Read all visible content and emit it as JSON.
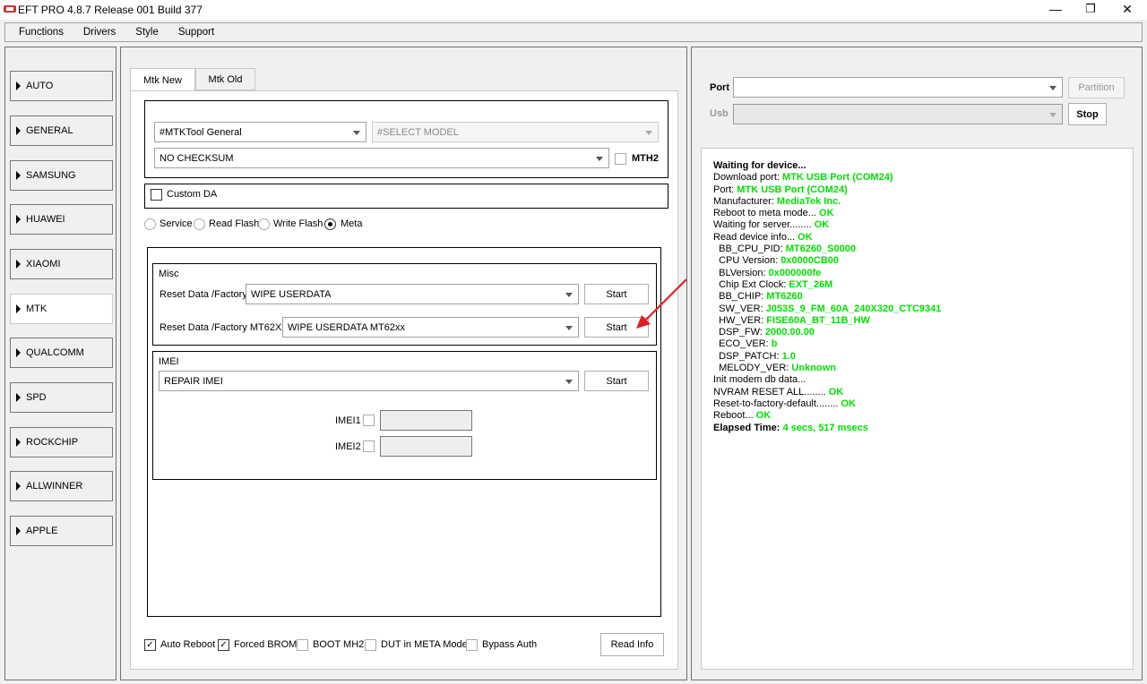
{
  "window": {
    "title": "EFT PRO 4.8.7 Release 001 Build 377",
    "minimize": "—",
    "maximize": "❐",
    "close": "✕"
  },
  "menu": [
    "Functions",
    "Drivers",
    "Style",
    "Support"
  ],
  "sidebar": {
    "items": [
      {
        "label": "AUTO"
      },
      {
        "label": "GENERAL"
      },
      {
        "label": "SAMSUNG"
      },
      {
        "label": "HUAWEI"
      },
      {
        "label": "XIAOMI"
      },
      {
        "label": "MTK",
        "active": true
      },
      {
        "label": "QUALCOMM"
      },
      {
        "label": "SPD"
      },
      {
        "label": "ROCKCHIP"
      },
      {
        "label": "ALLWINNER"
      },
      {
        "label": "APPLE"
      }
    ]
  },
  "tabs": [
    {
      "label": "Mtk New",
      "active": true
    },
    {
      "label": "Mtk Old",
      "active": false
    }
  ],
  "mtk": {
    "tool_select": "#MTKTool General",
    "model_select": "#SELECT MODEL",
    "checksum_select": "NO CHECKSUM",
    "mth2_label": "MTH2",
    "custom_da_label": "Custom DA",
    "modes": [
      {
        "label": "Service",
        "selected": false
      },
      {
        "label": "Read Flash",
        "selected": false
      },
      {
        "label": "Write Flash",
        "selected": false
      },
      {
        "label": "Meta",
        "selected": true
      }
    ],
    "misc": {
      "title": "Misc",
      "row1_label": "Reset Data /Factory",
      "row1_value": "WIPE USERDATA",
      "row1_button": "Start",
      "row2_label": "Reset Data /Factory MT62XX",
      "row2_value": "WIPE USERDATA MT62xx",
      "row2_button": "Start"
    },
    "imei": {
      "title": "IMEI",
      "select_value": "REPAIR IMEI",
      "button": "Start",
      "imei1_label": "IMEI1",
      "imei2_label": "IMEI2"
    },
    "options": [
      {
        "label": "Auto Reboot",
        "checked": true
      },
      {
        "label": "Forced BROM",
        "checked": true
      },
      {
        "label": "BOOT MH2",
        "checked": false
      },
      {
        "label": "DUT in META Mode",
        "checked": false
      },
      {
        "label": "Bypass Auth",
        "checked": false
      }
    ],
    "read_info_button": "Read Info"
  },
  "connection": {
    "port_label": "Port",
    "usb_label": "Usb",
    "partition_button": "Partition",
    "stop_button": "Stop"
  },
  "colors": {
    "log_value": "#00e000",
    "arrow": "#e02020"
  },
  "log": [
    {
      "text": "Waiting for device...",
      "value": "",
      "bold": true
    },
    {
      "text": "Download port: ",
      "value": "MTK USB Port (COM24)"
    },
    {
      "text": "Port: ",
      "value": "MTK USB Port (COM24)"
    },
    {
      "text": "Manufacturer: ",
      "value": "MediaTek Inc."
    },
    {
      "text": "Reboot to meta mode... ",
      "value": "OK"
    },
    {
      "text": "Waiting for server........ ",
      "value": "OK"
    },
    {
      "text": "Read device info... ",
      "value": "OK"
    },
    {
      "text": "  BB_CPU_PID: ",
      "value": "MT6260_S0000"
    },
    {
      "text": "  CPU Version: ",
      "value": "0x0000CB00"
    },
    {
      "text": "  BLVersion: ",
      "value": "0x000000fe"
    },
    {
      "text": "  Chip Ext Clock: ",
      "value": "EXT_26M"
    },
    {
      "text": "  BB_CHIP: ",
      "value": "MT6260"
    },
    {
      "text": "  SW_VER: ",
      "value": "J053S_9_FM_60A_240X320_CTC9341"
    },
    {
      "text": "  HW_VER: ",
      "value": "FISE60A_BT_11B_HW"
    },
    {
      "text": "  DSP_FW: ",
      "value": "2000.00.00"
    },
    {
      "text": "  ECO_VER: ",
      "value": "b"
    },
    {
      "text": "  DSP_PATCH: ",
      "value": "1.0"
    },
    {
      "text": "  MELODY_VER: ",
      "value": "Unknown"
    },
    {
      "text": "Init modem db data...",
      "value": ""
    },
    {
      "text": "NVRAM RESET ALL........ ",
      "value": "OK"
    },
    {
      "text": "Reset-to-factory-default........ ",
      "value": "OK"
    },
    {
      "text": "Reboot... ",
      "value": "OK"
    },
    {
      "text": "Elapsed Time: ",
      "value": "4 secs, 517 msecs",
      "bold": true
    }
  ]
}
